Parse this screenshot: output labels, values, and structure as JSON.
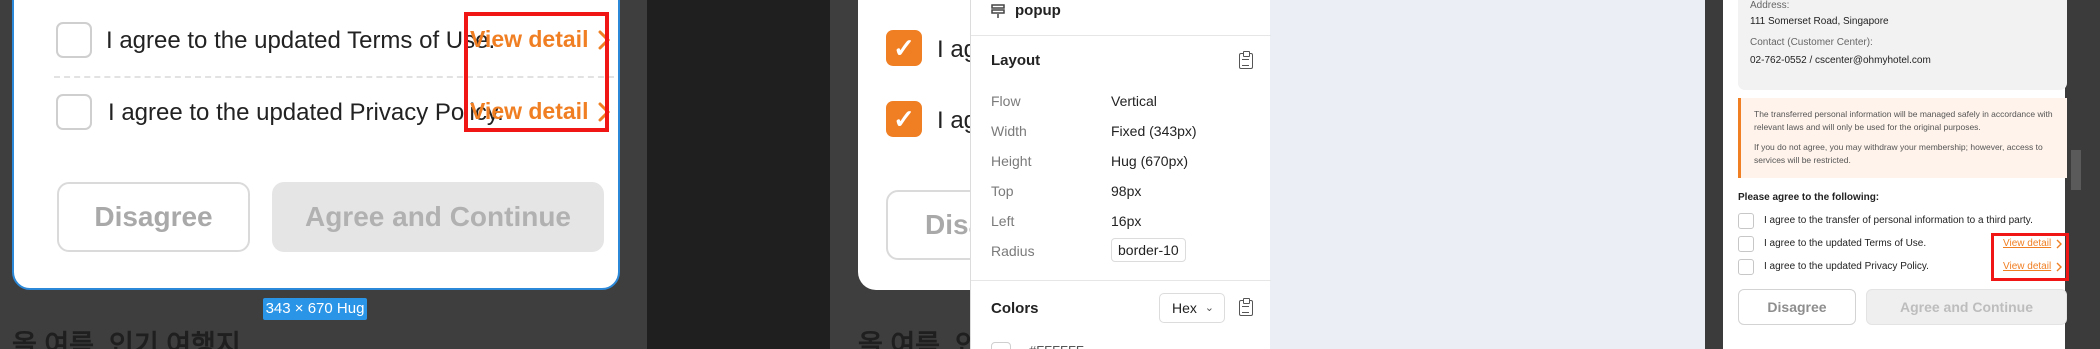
{
  "panel1": {
    "rows": [
      {
        "label": "I agree to the updated Terms of Use.",
        "link": "View detail"
      },
      {
        "label": "I agree to the updated Privacy Policy.",
        "link": "View detail"
      }
    ],
    "disagree": "Disagree",
    "agree_continue": "Agree and Continue",
    "dimension_tag": "343 × 670 Hug",
    "background_text": "올 여름, 인기 여행지"
  },
  "panel2": {
    "rows": [
      {
        "label": "I ag"
      },
      {
        "label": "I ag"
      }
    ],
    "disagree_partial": "Disa",
    "background_text": "올 여름, 인기 여행지"
  },
  "inspector": {
    "layer_name": "popup",
    "layout_title": "Layout",
    "props": [
      {
        "label": "Flow",
        "value": "Vertical"
      },
      {
        "label": "Width",
        "value": "Fixed (343px)"
      },
      {
        "label": "Height",
        "value": "Hug (670px)"
      },
      {
        "label": "Top",
        "value": "98px"
      },
      {
        "label": "Left",
        "value": "16px"
      },
      {
        "label": "Radius",
        "value": "border-10"
      }
    ],
    "colors_title": "Colors",
    "color_format": "Hex",
    "swatch_value": "#FFFFFF"
  },
  "panel4": {
    "address_label": "Address:",
    "address": "111 Somerset Road, Singapore",
    "contact_label": "Contact (Customer Center):",
    "contact": "02-762-0552 / cscenter@ohmyhotel.com",
    "notice_1": "The transferred personal information will be managed safely in accordance with relevant laws and will only be used for the original purposes.",
    "notice_2": "If you do not agree, you may withdraw your membership; however, access to services will be restricted.",
    "agree_heading": "Please agree to the following:",
    "items": [
      {
        "label": "I agree to the transfer of personal information to a third party.",
        "link": ""
      },
      {
        "label": "I agree to the updated Terms of Use.",
        "link": "View detail"
      },
      {
        "label": "I agree to the updated Privacy Policy.",
        "link": "View detail"
      }
    ],
    "disagree": "Disagree",
    "agree_continue": "Agree and Continue"
  },
  "colors": {
    "accent": "#f07f23",
    "highlight": "#f01616",
    "selection": "#2a94e6"
  }
}
